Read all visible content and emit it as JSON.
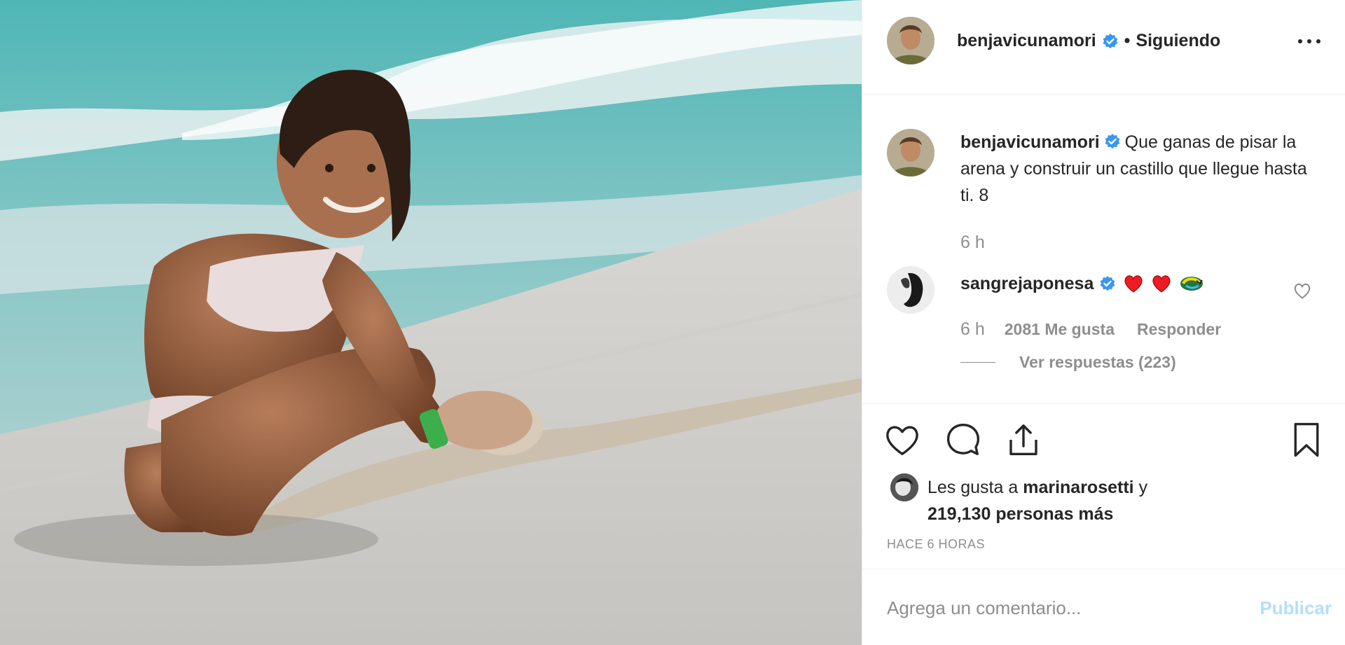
{
  "post": {
    "username": "benjavicunamori",
    "separator": "•",
    "follow_status": "Siguiendo",
    "caption_text": "Que ganas de pisar la arena y construir un castillo que llegue hasta ti. 8",
    "caption_time": "6 h"
  },
  "comment": {
    "username": "sangrejaponesa",
    "time": "6 h",
    "likes": "2081 Me gusta",
    "reply_label": "Responder",
    "view_replies": "Ver respuestas (223)"
  },
  "likes": {
    "prefix": "Les gusta a",
    "user": "marinarosetti",
    "joiner": "y",
    "count_text": "219,130 personas más"
  },
  "timestamp": "HACE 6 HORAS",
  "add_comment": {
    "placeholder": "Agrega un comentario...",
    "publish_label": "Publicar"
  },
  "colors": {
    "verified_blue": "#3897f0",
    "publish_disabled": "#b2dffc",
    "secondary_text": "#8e8e8e",
    "heart_red": "#ed1c24"
  },
  "icons": [
    "verified-badge-icon",
    "more-options-icon",
    "heart-icon",
    "comment-icon",
    "share-icon",
    "bookmark-icon",
    "small-heart-icon",
    "heart-emoji-icon",
    "recycle-emoji-icon"
  ]
}
